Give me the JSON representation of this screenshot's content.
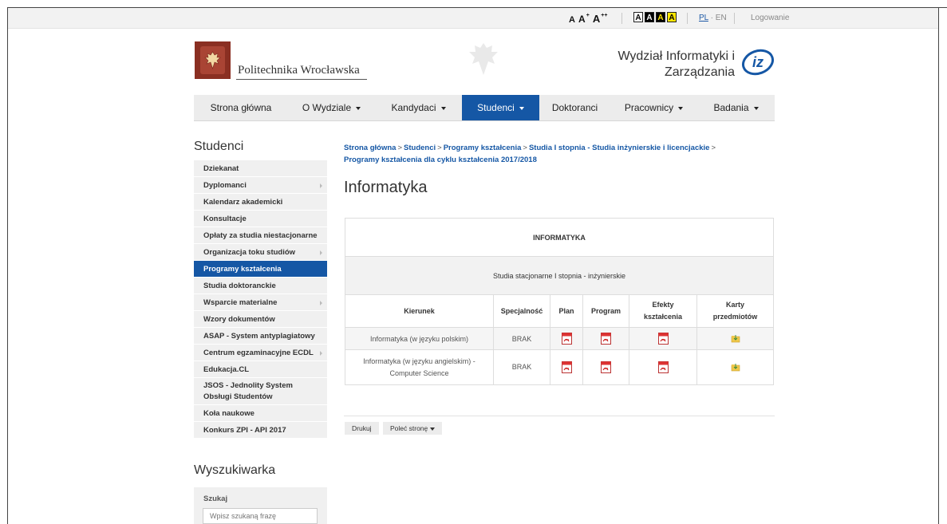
{
  "topbar": {
    "font_sizes": [
      "A",
      "A",
      "A"
    ],
    "contrast_options": [
      "A",
      "A",
      "A",
      "A"
    ],
    "lang_pl": "PL",
    "lang_sep": "·",
    "lang_en": "EN",
    "login": "Logowanie"
  },
  "header": {
    "university": "Politechnika Wrocławska",
    "faculty": "Wydział Informatyki i Zarządzania"
  },
  "nav": [
    {
      "label": "Strona główna",
      "dropdown": false,
      "active": false
    },
    {
      "label": "O Wydziale",
      "dropdown": true,
      "active": false
    },
    {
      "label": "Kandydaci",
      "dropdown": true,
      "active": false
    },
    {
      "label": "Studenci",
      "dropdown": true,
      "active": true
    },
    {
      "label": "Doktoranci",
      "dropdown": false,
      "active": false
    },
    {
      "label": "Pracownicy",
      "dropdown": true,
      "active": false
    },
    {
      "label": "Badania",
      "dropdown": true,
      "active": false
    }
  ],
  "sidebar": {
    "title": "Studenci",
    "items": [
      {
        "label": "Dziekanat",
        "submenu": false
      },
      {
        "label": "Dyplomanci",
        "submenu": true
      },
      {
        "label": "Kalendarz akademicki",
        "submenu": false
      },
      {
        "label": "Konsultacje",
        "submenu": false
      },
      {
        "label": "Opłaty za studia niestacjonarne",
        "submenu": false
      },
      {
        "label": "Organizacja toku studiów",
        "submenu": true
      },
      {
        "label": "Programy kształcenia",
        "submenu": false,
        "active": true
      },
      {
        "label": "Studia doktoranckie",
        "submenu": false
      },
      {
        "label": "Wsparcie materialne",
        "submenu": true
      },
      {
        "label": "Wzory dokumentów",
        "submenu": false
      },
      {
        "label": "ASAP - System antyplagiatowy",
        "submenu": false
      },
      {
        "label": "Centrum egzaminacyjne ECDL",
        "submenu": true
      },
      {
        "label": "Edukacja.CL",
        "submenu": false
      },
      {
        "label": "JSOS - Jednolity System Obsługi Studentów",
        "submenu": false,
        "tall": true
      },
      {
        "label": "Koła naukowe",
        "submenu": false
      },
      {
        "label": "Konkurs ZPI - API 2017",
        "submenu": false
      }
    ]
  },
  "search": {
    "title": "Wyszukiwarka",
    "label": "Szukaj",
    "placeholder": "Wpisz szukaną frazę"
  },
  "breadcrumb": {
    "items": [
      "Strona główna",
      "Studenci",
      "Programy kształcenia",
      "Studia I stopnia - Studia inżynierskie i licencjackie",
      "Programy kształcenia dla cyklu kształcenia 2017/2018"
    ],
    "separator": ">"
  },
  "page_title": "Informatyka",
  "table": {
    "title": "INFORMATYKA",
    "subtitle": "Studia stacjonarne I stopnia - inżynierskie",
    "columns": [
      "Kierunek",
      "Specjalność",
      "Plan",
      "Program",
      "Efekty kształcenia",
      "Karty przedmiotów"
    ],
    "rows": [
      {
        "kierunek": "Informatyka (w języku polskim)",
        "specjalnosc": "BRAK"
      },
      {
        "kierunek": "Informatyka (w języku angielskim) - Computer Science",
        "specjalnosc": "BRAK"
      }
    ]
  },
  "actions": {
    "print": "Drukuj",
    "recommend": "Poleć stronę"
  },
  "colors": {
    "accent": "#1557a5",
    "logo_red": "#8a2f22",
    "contrast_yellow": "#ffe600"
  }
}
